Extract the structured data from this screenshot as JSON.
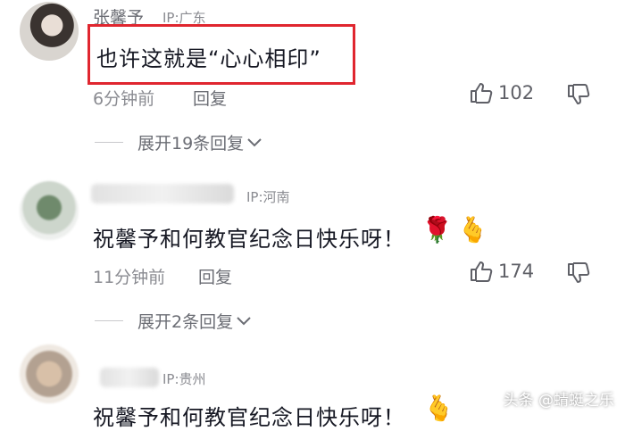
{
  "comments": [
    {
      "username": "张馨予",
      "ip": "IP:广东",
      "text": "也许这就是“心心相印”",
      "time": "6分钟前",
      "reply_label": "回复",
      "likes": "102",
      "expand_label": "展开19条回复"
    },
    {
      "username": "",
      "ip": "IP:河南",
      "text": "祝馨予和何教官纪念日快乐呀！",
      "emojis": [
        "🌹",
        "🫰"
      ],
      "time": "11分钟前",
      "reply_label": "回复",
      "likes": "174",
      "expand_label": "展开2条回复"
    },
    {
      "username": "",
      "ip": "IP:贵州",
      "text": "祝馨予和何教官纪念日快乐呀！",
      "emojis": [
        "🫰"
      ]
    }
  ],
  "watermark": "头条 @蜻蜓之乐",
  "colors": {
    "highlight": "#e0262f",
    "text": "#161823",
    "muted": "#8a8b91"
  }
}
